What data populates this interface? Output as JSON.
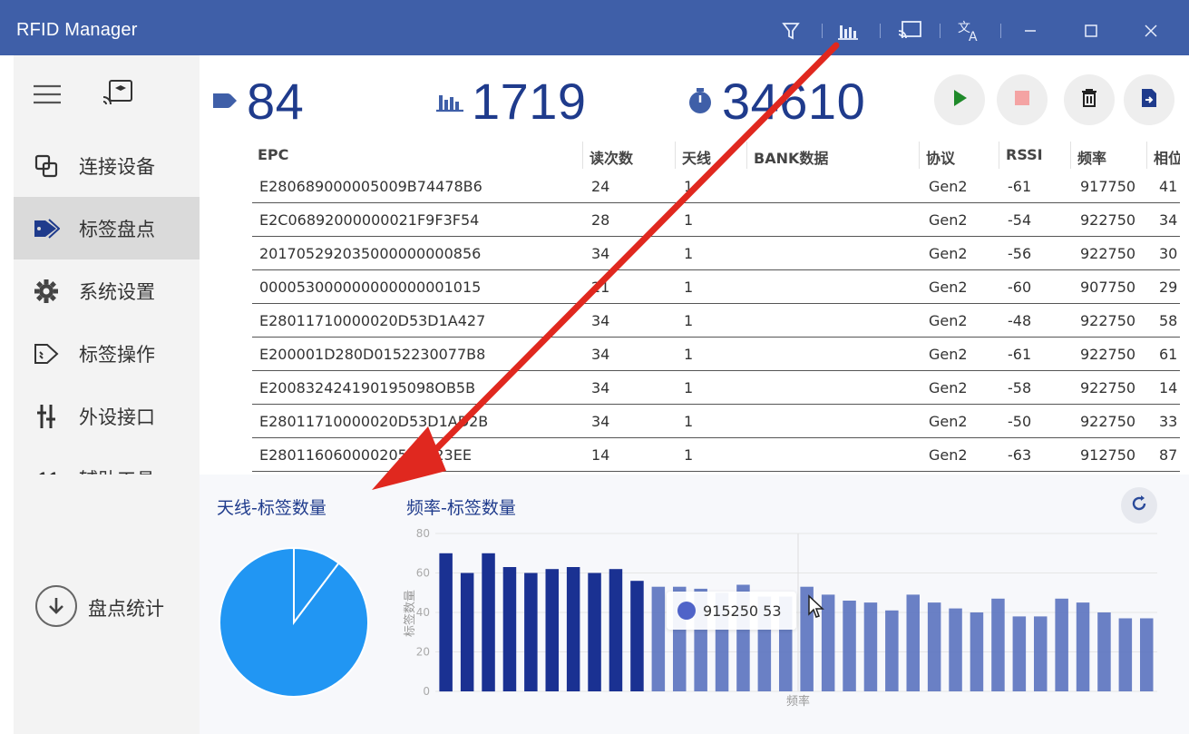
{
  "app": {
    "title": "RFID Manager"
  },
  "titlebar_icons": [
    "filter-icon",
    "bar-chart-icon",
    "cast-screen-icon",
    "translate-icon",
    "minimize-icon",
    "maximize-icon",
    "close-icon"
  ],
  "sidebar": {
    "items": [
      {
        "icon": "connect-device-icon",
        "label": "连接设备"
      },
      {
        "icon": "tag-icon",
        "label": "标签盘点",
        "active": true
      },
      {
        "icon": "gear-icon",
        "label": "系统设置"
      },
      {
        "icon": "tag-operation-icon",
        "label": "标签操作"
      },
      {
        "icon": "peripheral-icon",
        "label": "外设接口"
      },
      {
        "icon": "quote-icon",
        "label": "辅助工具"
      }
    ],
    "footer_label": "盘点统计"
  },
  "stats": {
    "tag_count": "84",
    "read_count": "1719",
    "elapsed": "34610"
  },
  "controls": [
    "play-icon",
    "stop-icon",
    "trash-icon",
    "export-icon"
  ],
  "colors": {
    "titlebar": "#3f5fa8",
    "accent": "#1f3b8c",
    "pie": "#2196f3",
    "bar_dark": "#1a3192",
    "bar_light": "#5a72bf"
  },
  "table": {
    "headers": [
      "EPC",
      "读次数",
      "天线",
      "BANK数据",
      "协议",
      "RSSI",
      "频率",
      "相位"
    ],
    "rows": [
      [
        "E280689000005009B74478B6",
        "24",
        "1",
        "",
        "Gen2",
        "-61",
        "917750",
        "41"
      ],
      [
        "E2C06892000000021F9F3F54",
        "28",
        "1",
        "",
        "Gen2",
        "-54",
        "922750",
        "34"
      ],
      [
        "201705292035000000000856",
        "34",
        "1",
        "",
        "Gen2",
        "-56",
        "922750",
        "30"
      ],
      [
        "000053000000000000001015",
        "21",
        "1",
        "",
        "Gen2",
        "-60",
        "907750",
        "29"
      ],
      [
        "E28011710000020D53D1A427",
        "34",
        "1",
        "",
        "Gen2",
        "-48",
        "922750",
        "58"
      ],
      [
        "E200001D280D0152230077B8",
        "34",
        "1",
        "",
        "Gen2",
        "-61",
        "922750",
        "61"
      ],
      [
        "E200832424190195098OB5B",
        "34",
        "1",
        "",
        "Gen2",
        "-58",
        "922750",
        "14"
      ],
      [
        "E28011710000020D53D1AD2B",
        "34",
        "1",
        "",
        "Gen2",
        "-50",
        "922750",
        "33"
      ],
      [
        "E28011606000020583423EE",
        "14",
        "1",
        "",
        "Gen2",
        "-63",
        "912750",
        "87"
      ]
    ]
  },
  "bottom": {
    "antenna_title": "天线-标签数量",
    "freq_title": "频率-标签数量",
    "tooltip": {
      "freq": "915250",
      "count": "53"
    }
  },
  "chart_data": [
    {
      "type": "pie",
      "title": "天线-标签数量",
      "slices": [
        {
          "value": 0.897
        },
        {
          "value": 0.103
        }
      ]
    },
    {
      "type": "bar",
      "title": "频率-标签数量",
      "xlabel": "频率",
      "ylabel": "标签数量",
      "ylim": [
        0,
        80
      ],
      "y_ticks": [
        "0",
        "20",
        "40",
        "60",
        "80"
      ],
      "values": [
        70,
        60,
        70,
        63,
        60,
        62,
        63,
        60,
        62,
        56,
        53,
        53,
        52,
        50,
        54,
        48,
        48,
        53,
        49,
        46,
        45,
        41,
        49,
        45,
        42,
        40,
        47,
        38,
        38,
        47,
        45,
        40,
        37,
        37
      ],
      "highlight_index": 10
    }
  ]
}
